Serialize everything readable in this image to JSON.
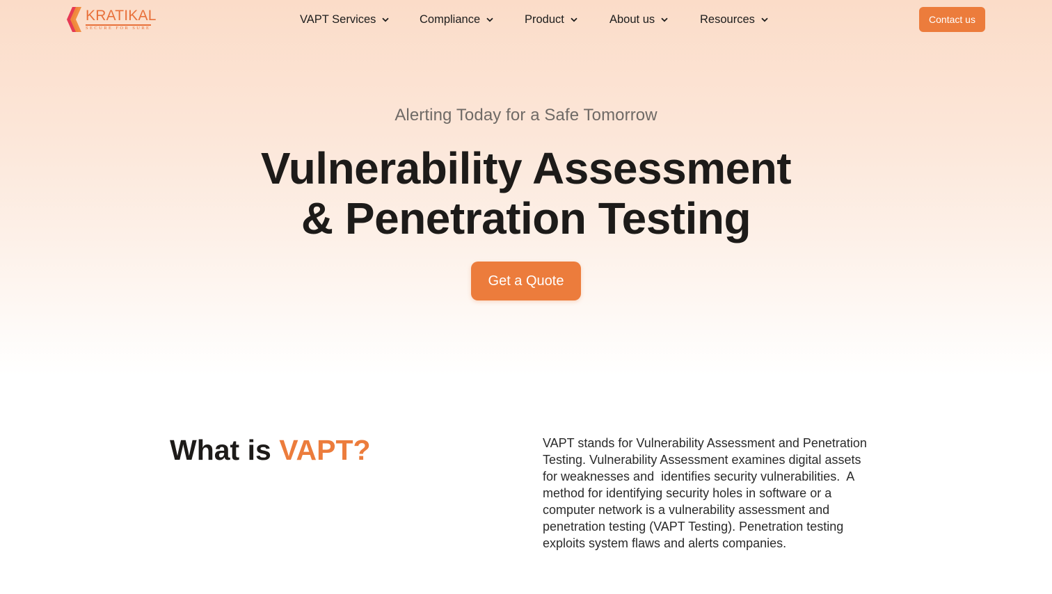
{
  "brand": {
    "name": "KRATIKAL",
    "tagline": "SECURE FOR SURE",
    "accent_color": "#ec7c3c"
  },
  "nav": {
    "items": [
      {
        "label": "VAPT Services",
        "icon": "chevron-down-icon"
      },
      {
        "label": "Compliance",
        "icon": "chevron-down-icon"
      },
      {
        "label": "Product",
        "icon": "chevron-down-icon"
      },
      {
        "label": "About us",
        "icon": "chevron-down-icon"
      },
      {
        "label": "Resources",
        "icon": "chevron-down-icon"
      }
    ],
    "contact_label": "Contact us"
  },
  "hero": {
    "eyebrow": "Alerting Today for a Safe Tomorrow",
    "title_line1": "Vulnerability Assessment",
    "title_line2": "& Penetration Testing",
    "cta_label": "Get a Quote"
  },
  "section": {
    "title_prefix": "What is ",
    "title_accent": "VAPT?",
    "body_lines": [
      "VAPT stands for Vulnerability Assessment and Penetration",
      "Testing. Vulnerability Assessment examines digital assets",
      "for weaknesses and  identifies security vulnerabilities.  A",
      "method for identifying security holes in software or a",
      "computer network is a vulnerability assessment and",
      "penetration testing (VAPT Testing). Penetration testing",
      "exploits system flaws and alerts companies."
    ]
  }
}
